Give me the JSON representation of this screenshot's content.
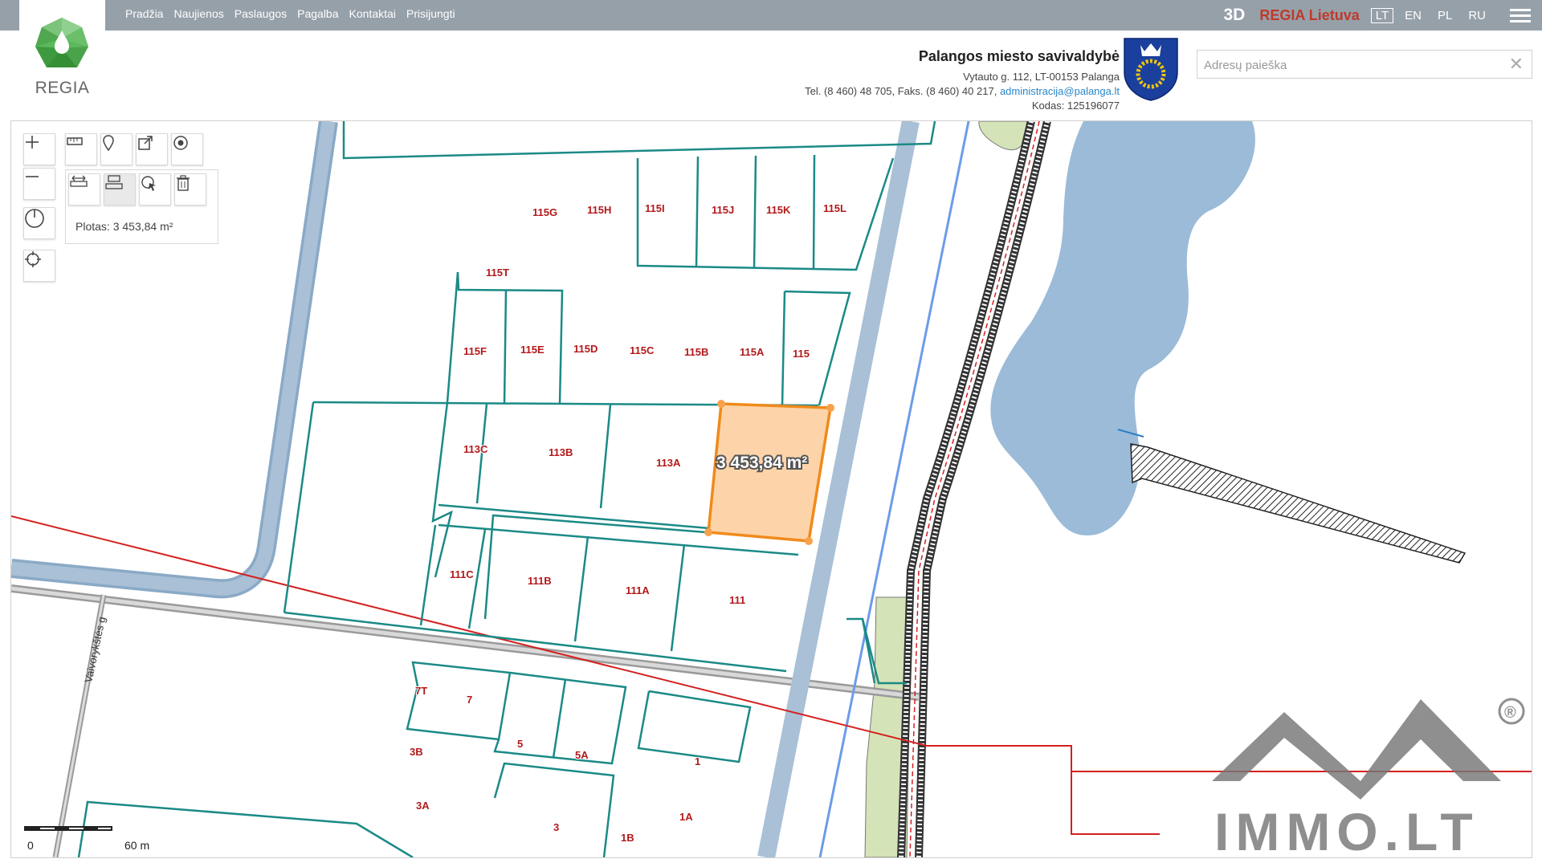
{
  "nav": {
    "items": [
      "Pradžia",
      "Naujienos",
      "Paslaugos",
      "Pagalba",
      "Kontaktai",
      "Prisijungti"
    ]
  },
  "top_right": {
    "btn_3d": "3D",
    "regia_lietuva": "REGIA Lietuva",
    "languages": [
      "LT",
      "EN",
      "PL",
      "RU"
    ],
    "active_language": "LT"
  },
  "logo": {
    "text": "REGIA"
  },
  "municipality": {
    "name": "Palangos miesto savivaldybė",
    "address": "Vytauto g. 112, LT-00153 Palanga",
    "phone": "Tel. (8 460) 48 705, Faks. (8 460) 40 217,",
    "email": "administracija@palanga.lt",
    "code": "Kodas: 125196077"
  },
  "search": {
    "placeholder": "Adresų paieška",
    "value": ""
  },
  "measure": {
    "area_text": "Plotas: 3 453,84 m²",
    "map_label": "3 453,84 m²",
    "area_value_m2": 3453.84
  },
  "parcel_labels": [
    "115G",
    "115H",
    "115I",
    "115J",
    "115K",
    "115L",
    "115T",
    "115F",
    "115E",
    "115D",
    "115C",
    "115B",
    "115A",
    "115",
    "113C",
    "113B",
    "113A",
    "111C",
    "111B",
    "111A",
    "111",
    "7T",
    "7",
    "3B",
    "5",
    "5A",
    "1",
    "3A",
    "3",
    "1A",
    "1B"
  ],
  "street_label": "Vaivorykštės g",
  "scale": {
    "start": "0",
    "end": "60 m"
  },
  "watermark": {
    "text": "IMMO.LT",
    "registered": "®"
  },
  "colors": {
    "topbar": "#96a0a9",
    "parcel_line": "#1b8a86",
    "parcel_label": "#b3191b",
    "selected_fill": "#fdd4a9",
    "selected_stroke": "#f08a1c",
    "water": "#9bbbd8",
    "road": "#a9c0d6",
    "green_area": "#d5e3b8",
    "red_line": "#d42020"
  },
  "icons": [
    "zoom-in-icon",
    "zoom-out-icon",
    "ruler-icon",
    "pin-icon",
    "export-icon",
    "radio-target-icon",
    "measure-distance-icon",
    "measure-area-icon",
    "cursor-select-icon",
    "trash-icon",
    "rotate-north-icon",
    "locate-icon"
  ]
}
